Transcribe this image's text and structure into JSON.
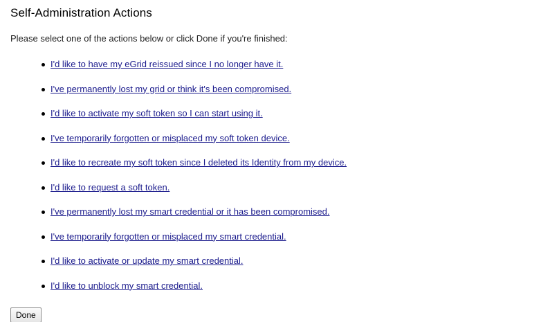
{
  "page": {
    "title": "Self-Administration Actions",
    "instructions": "Please select one of the actions below or click Done if you're finished:"
  },
  "actions": [
    {
      "label": "I'd like to have my eGrid reissued since I no longer have it."
    },
    {
      "label": "I've permanently lost my grid or think it's been compromised."
    },
    {
      "label": "I'd like to activate my soft token so I can start using it."
    },
    {
      "label": "I've temporarily forgotten or misplaced my soft token device."
    },
    {
      "label": "I'd like to recreate my soft token since I deleted its Identity from my device."
    },
    {
      "label": "I'd like to request a soft token."
    },
    {
      "label": "I've permanently lost my smart credential or it has been compromised."
    },
    {
      "label": "I've temporarily forgotten or misplaced my smart credential."
    },
    {
      "label": "I'd like to activate or update my smart credential."
    },
    {
      "label": "I'd like to unblock my smart credential."
    }
  ],
  "footer": {
    "done_label": "Done"
  },
  "colors": {
    "link": "#1a1a8c",
    "text": "#000000",
    "background": "#ffffff"
  }
}
